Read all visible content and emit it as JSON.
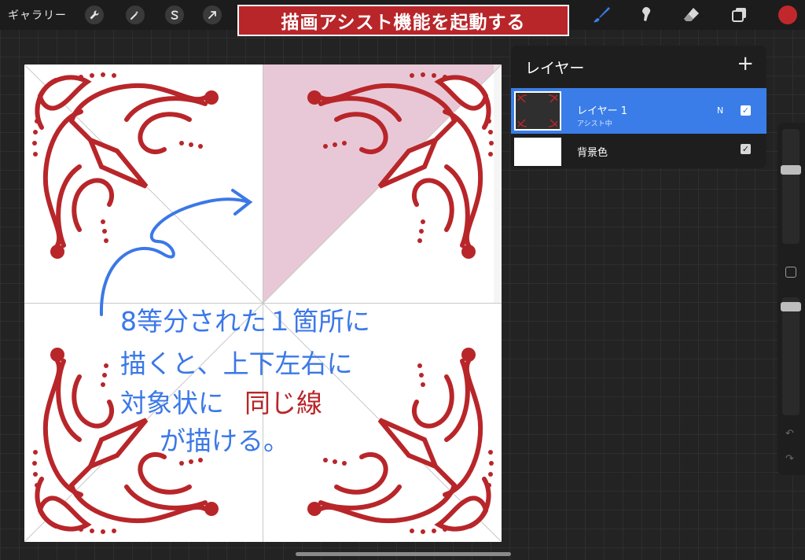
{
  "toolbar": {
    "gallery_label": "ギャラリー",
    "left_tools": [
      "wrench-icon",
      "magic-wand-icon",
      "selection-s-icon",
      "transform-arrow-icon"
    ],
    "right_tools": [
      "brush-icon",
      "smudge-icon",
      "eraser-icon",
      "layers-icon"
    ],
    "accent_color": "#3a7de8",
    "current_color": "#c0282c"
  },
  "banner": {
    "title": "描画アシスト機能を起動する"
  },
  "canvas": {
    "ornament_color": "#b8262a",
    "highlight_color": "#e8c8d6",
    "annotation_color": "#3b78e7",
    "annotation_lines": [
      "8等分された１箇所に",
      "描くと、上下左右に",
      "対象状に",
      "同じ線",
      "が描ける。"
    ]
  },
  "layers": {
    "title": "レイヤー",
    "add_label": "+",
    "items": [
      {
        "name": "レイヤー 1",
        "subtitle": "アシスト中",
        "blend": "N",
        "visible": "✓"
      },
      {
        "name": "背景色",
        "visible": "✓"
      }
    ]
  },
  "sidebar": {
    "undo_icon": "↶",
    "redo_icon": "↷"
  }
}
